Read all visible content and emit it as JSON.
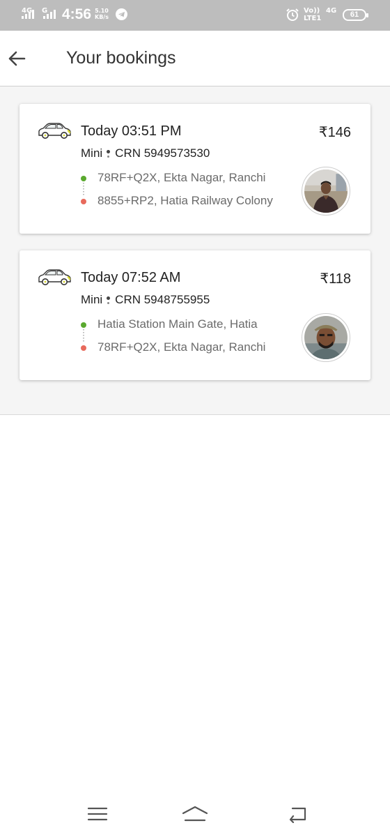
{
  "status_bar": {
    "sim1_network": "4G",
    "sim2_network": "G",
    "time": "4:56",
    "speed_value": "5.10",
    "speed_unit": "KB/s",
    "volte_line1": "Vo))",
    "volte_line2": "LTE1",
    "network_right": "4G",
    "battery": "61",
    "icons": [
      "signal-icon",
      "telegram-icon",
      "alarm-icon",
      "battery-icon"
    ]
  },
  "header": {
    "back_icon": "arrow-left-icon",
    "title": "Your bookings"
  },
  "colors": {
    "pickup_dot": "#5aa92f",
    "drop_dot": "#e86a5c",
    "list_background": "#f5f5f5"
  },
  "bookings": [
    {
      "icon": "car-icon",
      "when": "Today 03:51 PM",
      "fare": "₹146",
      "cab_type": "Mini",
      "crn": "CRN 5949573530",
      "pickup": "78RF+Q2X, Ekta Nagar, Ranchi",
      "drop": "8855+RP2, Hatia Railway Colony",
      "driver_avatar": "driver-photo"
    },
    {
      "icon": "car-icon",
      "when": "Today 07:52 AM",
      "fare": "₹118",
      "cab_type": "Mini",
      "crn": "CRN 5948755955",
      "pickup": "Hatia Station Main Gate, Hatia",
      "drop": "78RF+Q2X, Ekta Nagar, Ranchi",
      "driver_avatar": "driver-photo"
    }
  ],
  "nav_bar": {
    "icons": [
      "menu-icon",
      "home-icon",
      "back-icon"
    ]
  }
}
